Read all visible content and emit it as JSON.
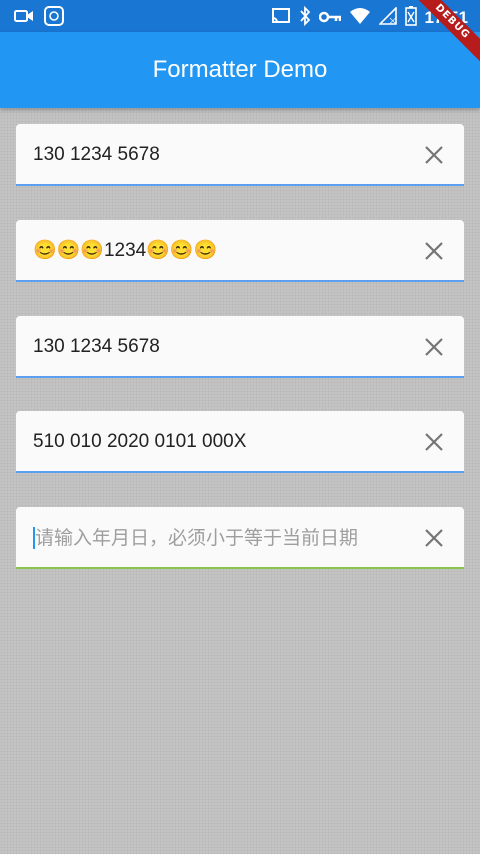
{
  "status_bar": {
    "time": "17:51",
    "left_icons": [
      "video-camera-icon",
      "ifly-icon"
    ],
    "right_icons": [
      "cast-icon",
      "bluetooth-icon",
      "vpn-key-icon",
      "wifi-icon",
      "no-signal-icon",
      "battery-icon"
    ]
  },
  "app_bar": {
    "title": "Formatter Demo",
    "color": "#2196f3"
  },
  "debug_banner": "DEBUG",
  "fields": [
    {
      "value": "130 1234 5678",
      "placeholder": ""
    },
    {
      "value": "😊😊😊1234😊😊😊",
      "placeholder": ""
    },
    {
      "value": "130 1234 5678",
      "placeholder": ""
    },
    {
      "value": "510 010 2020 0101 000X",
      "placeholder": ""
    },
    {
      "value": "",
      "placeholder": "请输入年月日，必须小于等于当前日期"
    }
  ],
  "clear_icon": "close-icon"
}
